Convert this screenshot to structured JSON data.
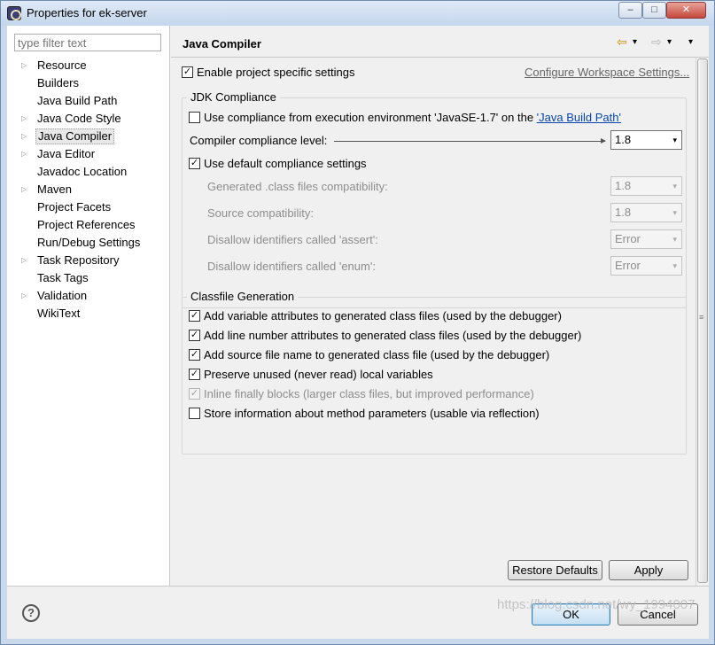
{
  "window": {
    "title": "Properties for ek-server",
    "minimize": "–",
    "maximize": "□",
    "close": "✕"
  },
  "sidebar": {
    "filter_placeholder": "type filter text",
    "items": [
      {
        "label": "Resource",
        "expandable": true
      },
      {
        "label": "Builders",
        "expandable": false
      },
      {
        "label": "Java Build Path",
        "expandable": false
      },
      {
        "label": "Java Code Style",
        "expandable": true
      },
      {
        "label": "Java Compiler",
        "expandable": true,
        "selected": true
      },
      {
        "label": "Java Editor",
        "expandable": true
      },
      {
        "label": "Javadoc Location",
        "expandable": false
      },
      {
        "label": "Maven",
        "expandable": true
      },
      {
        "label": "Project Facets",
        "expandable": false
      },
      {
        "label": "Project References",
        "expandable": false
      },
      {
        "label": "Run/Debug Settings",
        "expandable": false
      },
      {
        "label": "Task Repository",
        "expandable": true
      },
      {
        "label": "Task Tags",
        "expandable": false
      },
      {
        "label": "Validation",
        "expandable": true
      },
      {
        "label": "WikiText",
        "expandable": false
      }
    ]
  },
  "page": {
    "title": "Java Compiler",
    "back_glyph": "⇦",
    "forward_glyph": "⇨",
    "dropdown_glyph": "▾",
    "enable_specific": "Enable project specific settings",
    "configure_link": "Configure Workspace Settings...",
    "jdk": {
      "group_title": "JDK Compliance",
      "use_env_prefix": "Use compliance from execution environment 'JavaSE-1.7' on the ",
      "use_env_link": "'Java Build Path'",
      "compliance_label": "Compiler compliance level:",
      "compliance_value": "1.8",
      "use_default": "Use default compliance settings",
      "generated_label": "Generated .class files compatibility:",
      "generated_value": "1.8",
      "source_label": "Source compatibility:",
      "source_value": "1.8",
      "assert_label": "Disallow identifiers called 'assert':",
      "assert_value": "Error",
      "enum_label": "Disallow identifiers called 'enum':",
      "enum_value": "Error"
    },
    "classfile": {
      "group_title": "Classfile Generation",
      "options": [
        {
          "label": "Add variable attributes to generated class files (used by the debugger)",
          "checked": true,
          "disabled": false
        },
        {
          "label": "Add line number attributes to generated class files (used by the debugger)",
          "checked": true,
          "disabled": false
        },
        {
          "label": "Add source file name to generated class file (used by the debugger)",
          "checked": true,
          "disabled": false
        },
        {
          "label": "Preserve unused (never read) local variables",
          "checked": true,
          "disabled": false
        },
        {
          "label": "Inline finally blocks (larger class files, but improved performance)",
          "checked": true,
          "disabled": true
        },
        {
          "label": "Store information about method parameters (usable via reflection)",
          "checked": false,
          "disabled": false
        }
      ]
    },
    "restore_defaults": "Restore Defaults",
    "apply": "Apply"
  },
  "footer": {
    "help": "?",
    "ok": "OK",
    "cancel": "Cancel"
  },
  "watermark": "https://blog.csdn.net/wy_1994007",
  "checkmark": "✓",
  "combo_arrow": "▾"
}
